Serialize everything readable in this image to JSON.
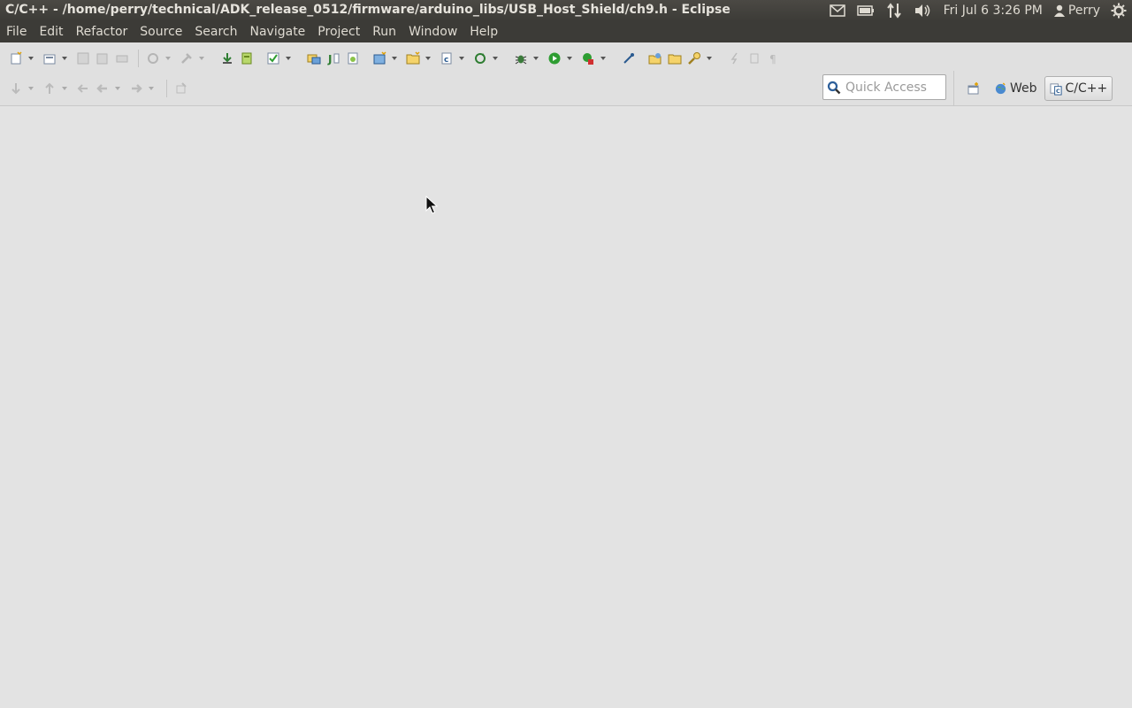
{
  "window": {
    "title": "C/C++ - /home/perry/technical/ADK_release_0512/firmware/arduino_libs/USB_Host_Shield/ch9.h - Eclipse"
  },
  "system_tray": {
    "clock": "Fri Jul  6  3:26 PM",
    "user": "Perry",
    "icons": [
      "mail-icon",
      "battery-icon",
      "network-icon",
      "volume-icon",
      "power-icon"
    ]
  },
  "menubar": {
    "items": [
      "File",
      "Edit",
      "Refactor",
      "Source",
      "Search",
      "Navigate",
      "Project",
      "Run",
      "Window",
      "Help"
    ]
  },
  "quick_access": {
    "placeholder": "Quick Access",
    "value": ""
  },
  "perspectives": {
    "web_label": "Web",
    "cpp_label": "C/C++",
    "active": "C/C++"
  },
  "colors": {
    "panel_bg": "#3c3b37",
    "panel_text": "#dfdbd2",
    "workbench_bg": "#e3e3e3"
  }
}
